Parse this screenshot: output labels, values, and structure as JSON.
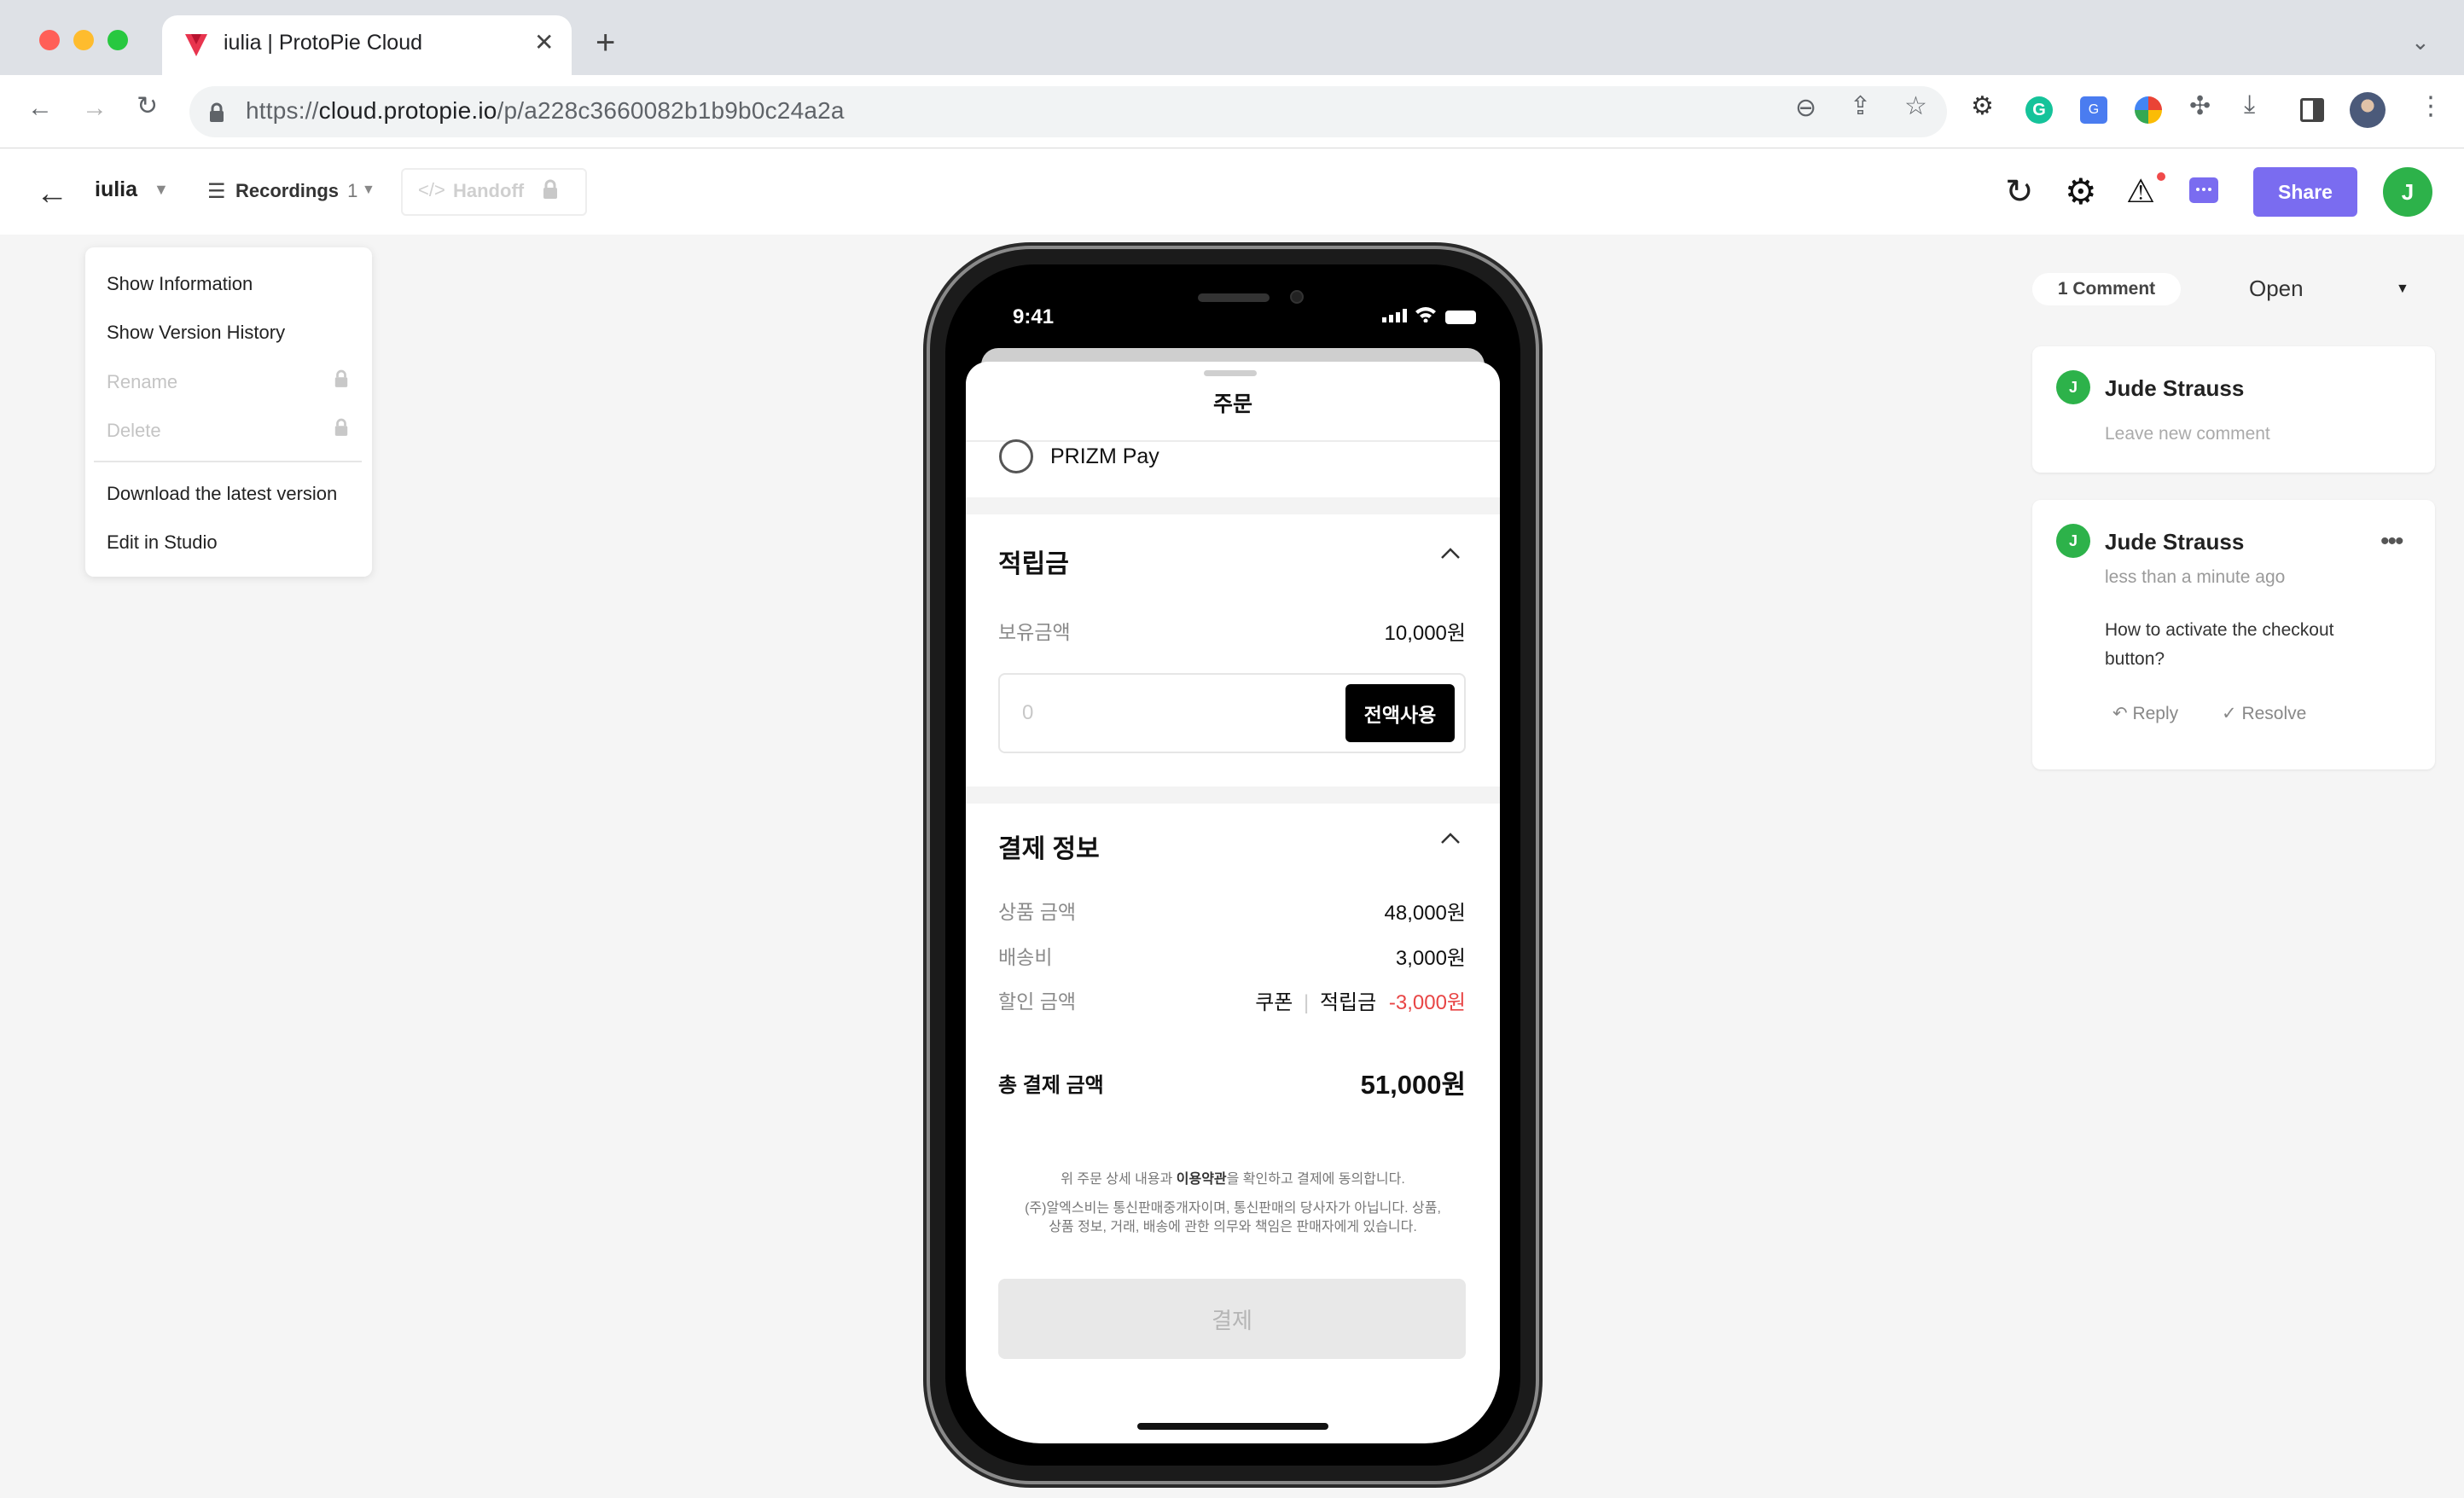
{
  "browser": {
    "tab_title": "iulia | ProtoPie Cloud",
    "new_tab": "+",
    "url_prefix": "https://",
    "url_host": "cloud.protopie.io",
    "url_path": "/p/a228c3660082b1b9b0c24a2a"
  },
  "header": {
    "project_name": "iulia",
    "recordings_label": "Recordings",
    "recordings_count": "1",
    "handoff_label": "Handoff",
    "share_label": "Share",
    "avatar_letter": "J",
    "accent": "#7a6cf0"
  },
  "menu": {
    "items": [
      {
        "label": "Show Information",
        "enabled": true
      },
      {
        "label": "Show Version History",
        "enabled": true
      },
      {
        "label": "Rename",
        "enabled": false
      },
      {
        "label": "Delete",
        "enabled": false
      },
      {
        "label": "Download the latest version",
        "enabled": true
      },
      {
        "label": "Edit in Studio",
        "enabled": true
      }
    ]
  },
  "phone": {
    "time": "9:41",
    "sheet_title": "주문",
    "payment_option": "PRIZM Pay",
    "points": {
      "title": "적립금",
      "balance_label": "보유금액",
      "balance_value": "10,000원",
      "input_placeholder": "0",
      "use_all_button": "전액사용"
    },
    "payment_info": {
      "title": "결제 정보",
      "rows": [
        {
          "label": "상품 금액",
          "value": "48,000원"
        },
        {
          "label": "배송비",
          "value": "3,000원"
        }
      ],
      "discount_label": "할인 금액",
      "discount_coupon": "쿠폰",
      "discount_points": "적립금",
      "discount_value": "-3,000원",
      "total_label": "총 결제 금액",
      "total_value": "51,000원"
    },
    "notice_line1_pre": "위 주문 상세 내용과 ",
    "notice_line1_bold": "이용약관",
    "notice_line1_post": "을 확인하고 결제에 동의합니다.",
    "notice_line2": "(주)알엑스비는 통신판매중개자이며, 통신판매의 당사자가 아닙니다. 상품,",
    "notice_line3": "상품 정보, 거래, 배송에 관한 의무와 책임은 판매자에게 있습니다.",
    "pay_button": "결제"
  },
  "comments": {
    "count_label": "1 Comment",
    "filter_label": "Open",
    "new_comment": {
      "author": "Jude Strauss",
      "placeholder": "Leave new comment"
    },
    "thread": {
      "author": "Jude Strauss",
      "time": "less than a minute ago",
      "text_line1": "How to activate the checkout",
      "text_line2": "button?",
      "reply_label": "Reply",
      "resolve_label": "Resolve"
    }
  }
}
